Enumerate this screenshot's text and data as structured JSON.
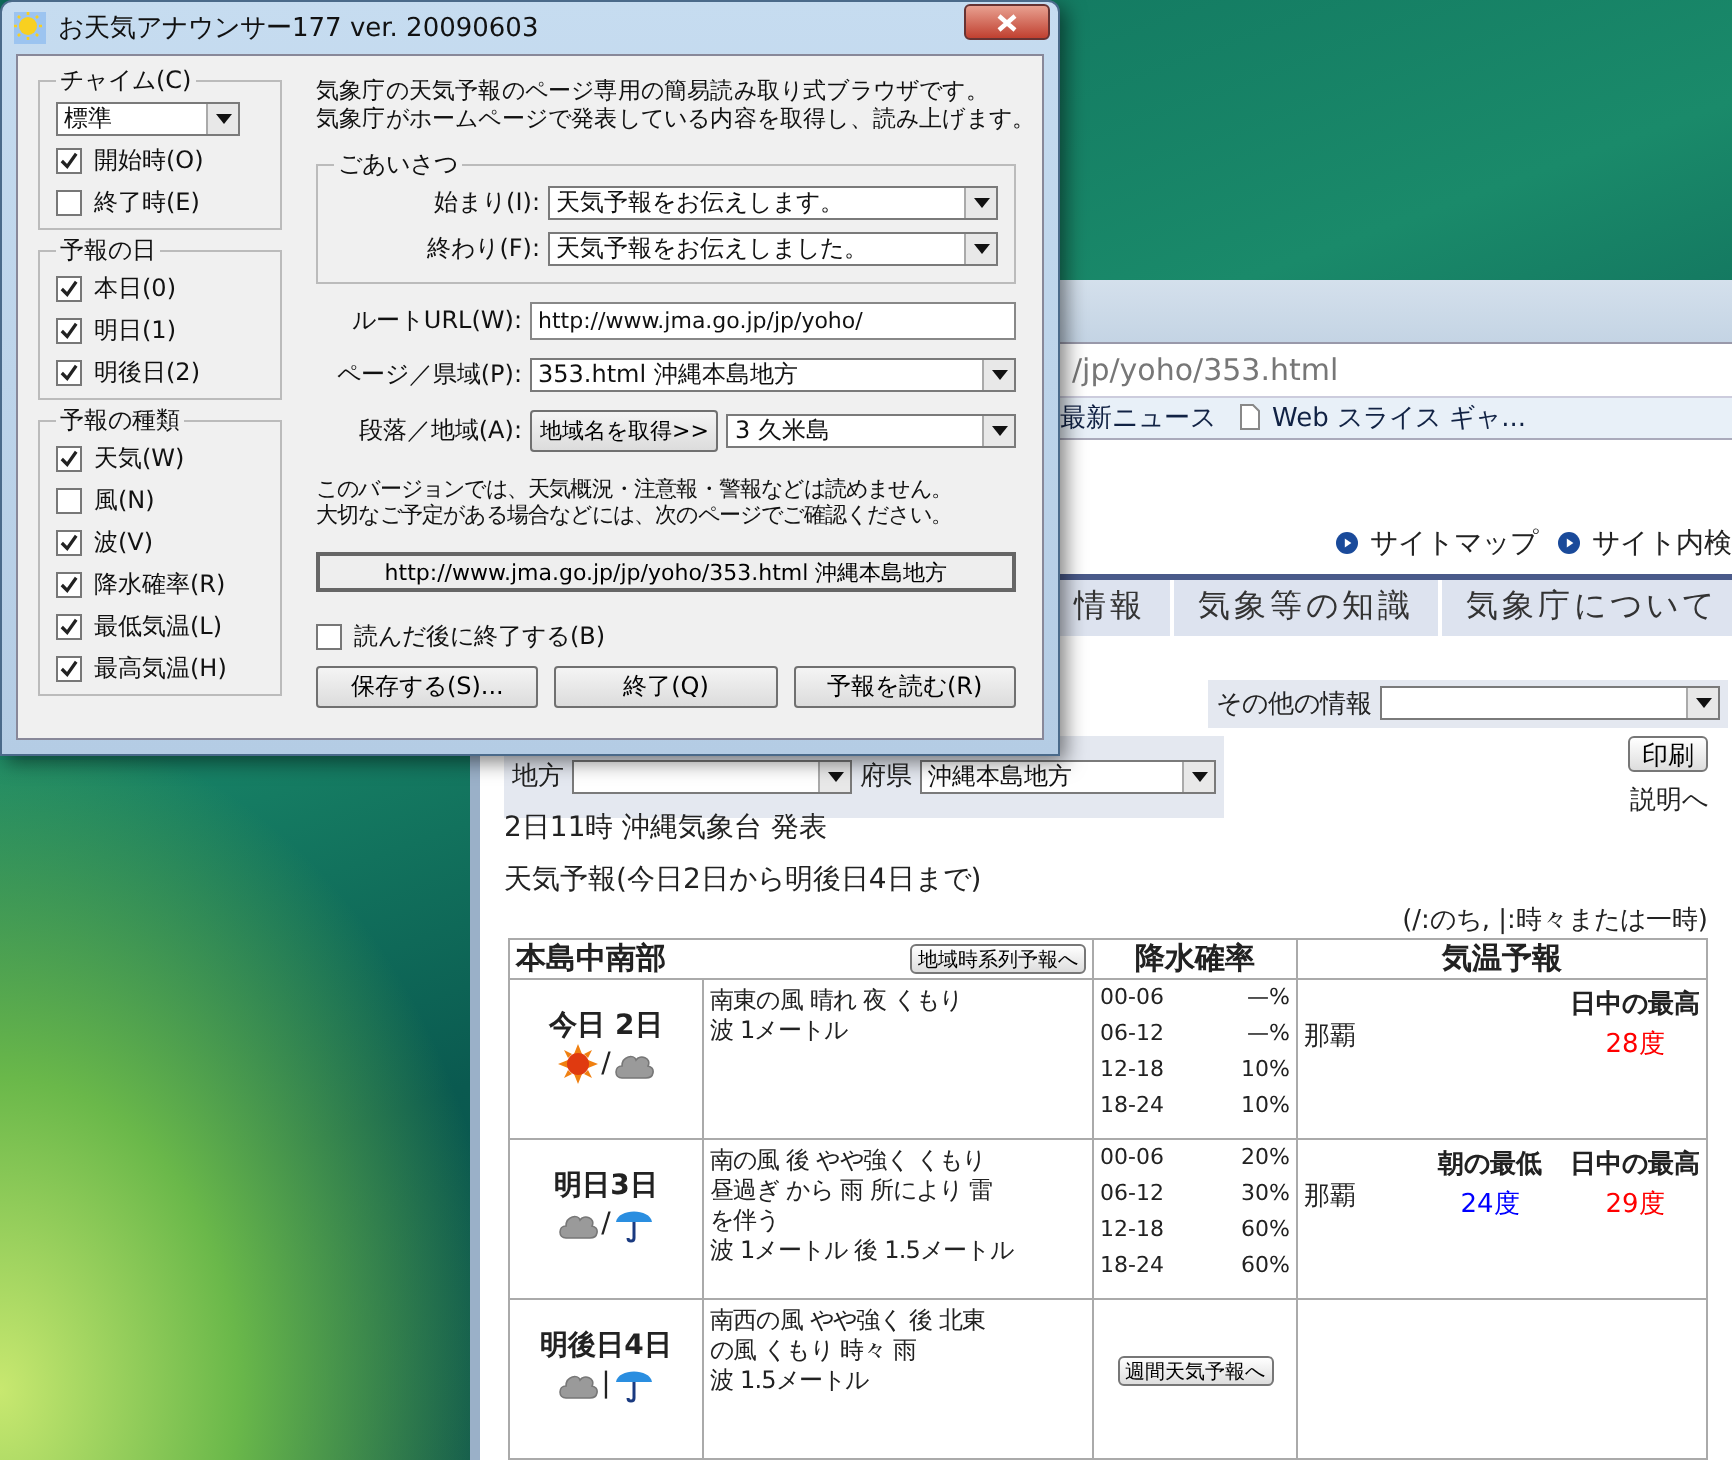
{
  "dialog": {
    "title": "お天気アナウンサー177 ver. 20090603",
    "chime": {
      "label": "チャイム(C)",
      "select": "標準",
      "options": [
        {
          "label": "開始時(O)",
          "checked": true
        },
        {
          "label": "終了時(E)",
          "checked": false
        }
      ]
    },
    "days": {
      "label": "予報の日",
      "options": [
        {
          "label": "本日(0)",
          "checked": true
        },
        {
          "label": "明日(1)",
          "checked": true
        },
        {
          "label": "明後日(2)",
          "checked": true
        }
      ]
    },
    "kinds": {
      "label": "予報の種類",
      "options": [
        {
          "label": "天気(W)",
          "checked": true
        },
        {
          "label": "風(N)",
          "checked": false
        },
        {
          "label": "波(V)",
          "checked": true
        },
        {
          "label": "降水確率(R)",
          "checked": true
        },
        {
          "label": "最低気温(L)",
          "checked": true
        },
        {
          "label": "最高気温(H)",
          "checked": true
        }
      ]
    },
    "description": [
      "気象庁の天気予報のページ専用の簡易読み取り式ブラウザです。",
      "気象庁がホームページで発表している内容を取得し、読み上げます。"
    ],
    "greeting": {
      "label": "ごあいさつ",
      "fields": [
        {
          "label": "始まり(I):",
          "value": "天気予報をお伝えします。"
        },
        {
          "label": "終わり(F):",
          "value": "天気予報をお伝えしました。"
        }
      ]
    },
    "fields": [
      {
        "kind": "input",
        "label": "ルートURL(W):",
        "value": "http://www.jma.go.jp/jp/yoho/"
      },
      {
        "kind": "select",
        "label": "ページ／県域(P):",
        "value": "353.html 沖縄本島地方"
      },
      {
        "kind": "button_select",
        "label": "段落／地域(A):",
        "button": "地域名を取得>>",
        "value": "3 久米島"
      }
    ],
    "notice": [
      "このバージョンでは、天気概況・注意報・警報などは読めません。",
      "大切なご予定がある場合などには、次のページでご確認ください。"
    ],
    "url_display": "http://www.jma.go.jp/jp/yoho/353.html 沖縄本島地方",
    "exit_after": {
      "label": "読んだ後に終了する(B)",
      "checked": false
    },
    "buttons": [
      "保存する(S)...",
      "終了(Q)",
      "予報を読む(R)"
    ]
  },
  "browser": {
    "address": "/jp/yoho/353.html",
    "favorites": [
      {
        "label": "最新ニュース",
        "icon": false
      },
      {
        "label": "Web スライス ギャ...",
        "icon": true
      }
    ],
    "site_links": [
      "サイトマップ",
      "サイト内検"
    ],
    "nav": [
      "情報",
      "気象等の知識",
      "気象庁について"
    ],
    "other_info": "その他の情報",
    "region": "地方",
    "prefecture": {
      "label": "府県",
      "value": "沖縄本島地方"
    },
    "print": "印刷",
    "explain": "説明へ",
    "issued": "2日11時 沖縄気象台 発表",
    "heading": "天気予報(今日2日から明後日4日まで)",
    "legend": "(/:のち, |:時々または一時)",
    "table": {
      "area": "本島中南部",
      "area_button": "地域時系列予報へ",
      "columns": [
        "降水確率",
        "気温予報"
      ],
      "rows": [
        {
          "day": "今日 2日",
          "icons": [
            {
              "kind": "sun"
            },
            {
              "kind": "cloud"
            }
          ],
          "sep": "/",
          "forecast": [
            "南東の風 晴れ 夜 くもり",
            "波 1メートル"
          ],
          "rain": [
            {
              "time": "00-06",
              "value": "—%"
            },
            {
              "time": "06-12",
              "value": "—%"
            },
            {
              "time": "12-18",
              "value": "10%"
            },
            {
              "time": "18-24",
              "value": "10%"
            }
          ],
          "temps": {
            "city": "那覇",
            "columns": [
              {
                "header": "日中の最高",
                "value": "28度",
                "kind": "high"
              }
            ]
          }
        },
        {
          "day": "明日3日",
          "icons": [
            {
              "kind": "cloud"
            },
            {
              "kind": "umbrella"
            }
          ],
          "sep": "/",
          "forecast": [
            "南の風 後 やや強く くもり",
            "昼過ぎ から 雨 所により 雷",
            "を伴う",
            "波 1メートル 後 1.5メートル"
          ],
          "rain": [
            {
              "time": "00-06",
              "value": "20%"
            },
            {
              "time": "06-12",
              "value": "30%"
            },
            {
              "time": "12-18",
              "value": "60%"
            },
            {
              "time": "18-24",
              "value": "60%"
            }
          ],
          "temps": {
            "city": "那覇",
            "columns": [
              {
                "header": "朝の最低",
                "value": "24度",
                "kind": "low"
              },
              {
                "header": "日中の最高",
                "value": "29度",
                "kind": "high"
              }
            ]
          }
        },
        {
          "day": "明後日4日",
          "icons": [
            {
              "kind": "cloud"
            },
            {
              "kind": "umbrella"
            }
          ],
          "sep": "|",
          "forecast": [
            "南西の風 やや強く 後 北東",
            "の風 くもり 時々 雨",
            "波 1.5メートル"
          ],
          "rain_button": "週間天気予報へ"
        }
      ]
    }
  }
}
